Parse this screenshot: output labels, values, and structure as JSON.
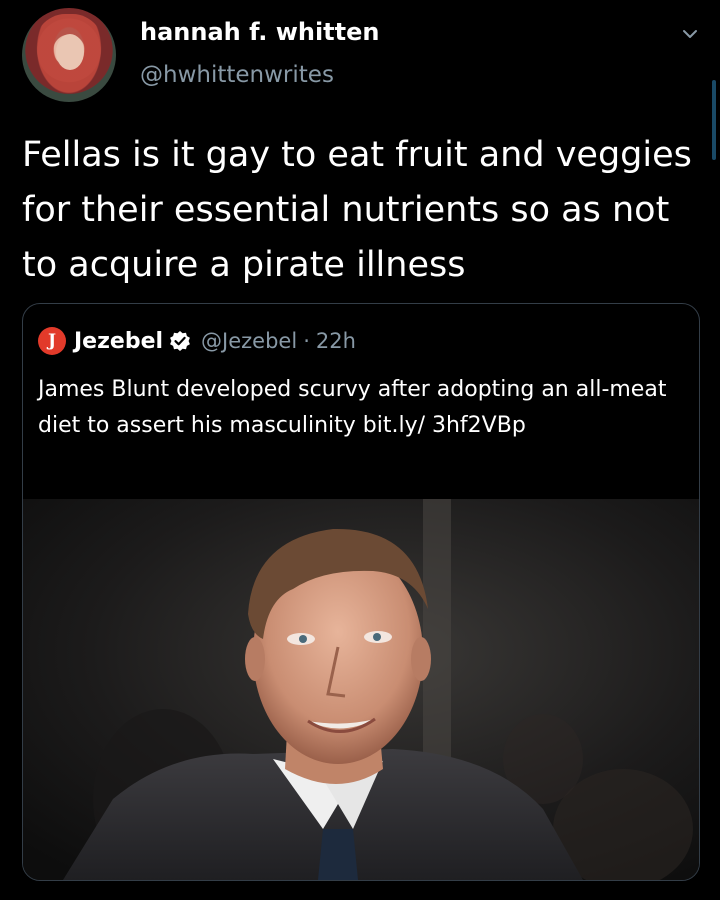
{
  "tweet": {
    "author": {
      "display_name": "hannah f. whitten",
      "handle": "@hwhittenwrites",
      "avatar": "profile-photo"
    },
    "menu_icon": "chevron-down-icon",
    "text": "Fellas is it gay to eat fruit and veggies for their essential nutrients so as not to acquire a pirate illness"
  },
  "quote": {
    "source_name": "Jezebel",
    "verified_icon": "verified-badge-icon",
    "handle": "@Jezebel",
    "separator": "·",
    "time": "22h",
    "text": "James Blunt developed scurvy after adopting an all-meat diet to assert his masculinity bit.ly/ 3hf2VBp",
    "media": "news-photo",
    "logo_letter": "J"
  },
  "colors": {
    "background": "#000000",
    "secondary_text": "#8899a6",
    "border": "#333d47",
    "verified": "#ffffff",
    "jezebel_red": "#e23a2a"
  }
}
